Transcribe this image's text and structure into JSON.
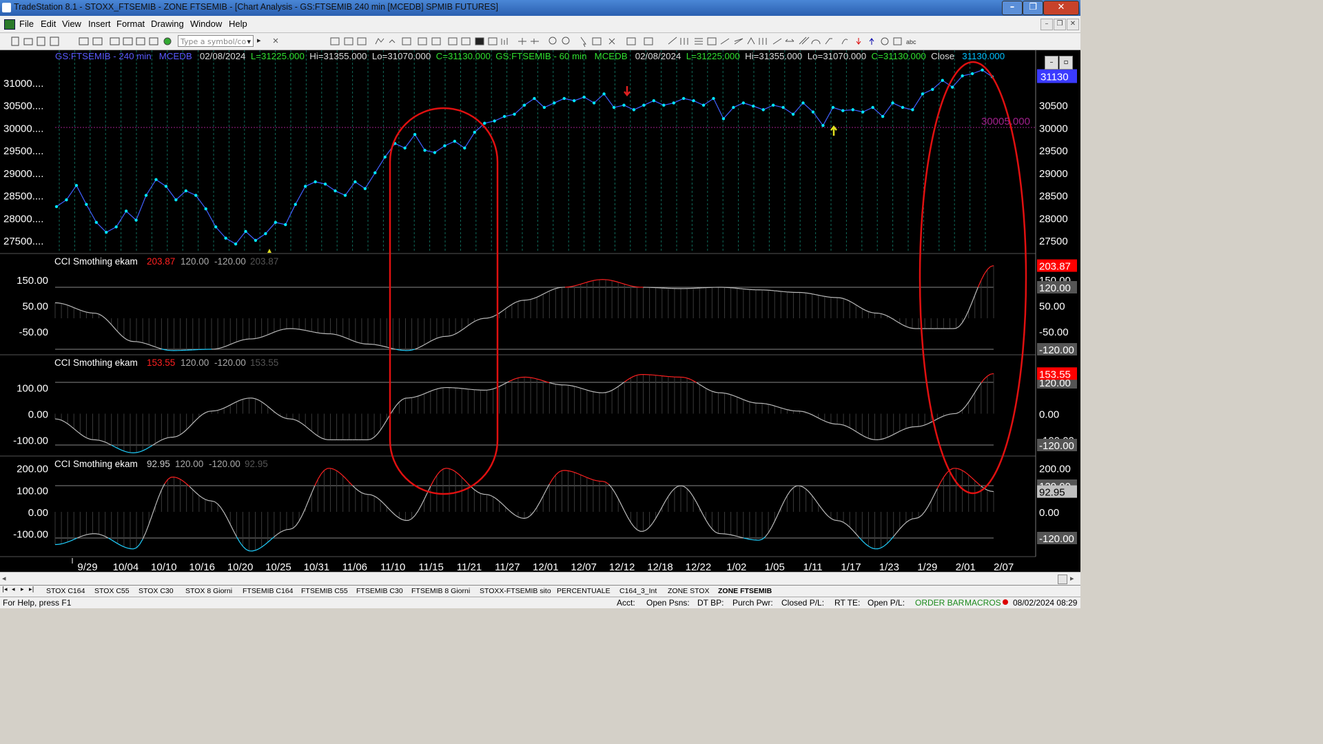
{
  "window": {
    "title": "TradeStation 8.1 - STOXX_FTSEMIB - ZONE FTSEMIB - [Chart Analysis - GS:FTSEMIB  240 min  [MCEDB] SPMIB FUTURES]"
  },
  "menu": {
    "items": [
      "File",
      "Edit",
      "View",
      "Insert",
      "Format",
      "Drawing",
      "Window",
      "Help"
    ]
  },
  "toolbar": {
    "symbol_placeholder": "Type a symbol/co"
  },
  "header": {
    "s1_name": "GS:FTSEMIB - 240 min",
    "s1_feed": "MCEDB",
    "s1_date": "02/08/2024",
    "s1_last": "L=31225.000",
    "s1_hi": "Hi=31355.000",
    "s1_lo": "Lo=31070.000",
    "s1_close": "C=31130.000",
    "s2_name": "GS:FTSEMIB - 60 min",
    "s2_feed": "MCEDB",
    "s2_date": "02/08/2024",
    "s2_last": "L=31225.000",
    "s2_hi": "Hi=31355.000",
    "s2_lo": "Lo=31070.000",
    "s2_close": "C=31130.000",
    "close_label": "Close",
    "close_value": "31130.000"
  },
  "price_panel": {
    "left_ticks": [
      "31000....",
      "30500....",
      "30000....",
      "29500....",
      "29000....",
      "28500....",
      "28000....",
      "27500...."
    ],
    "right_ticks": [
      "30500",
      "30000",
      "29500",
      "29000",
      "28500",
      "28000",
      "27500"
    ],
    "last_price_badge": "31130",
    "hline_label": "30005.000",
    "colors": {
      "price_line": "#4060ff",
      "markers": "#00e5ff",
      "hline": "#a0208c",
      "badge": "#3a3aff"
    }
  },
  "indicators": [
    {
      "name": "CCI Smothing ekam",
      "value": "203.87",
      "upper": "120.00",
      "lower": "-120.00",
      "value_dim": "203.87",
      "left_ticks": [
        "150.00",
        "50.00",
        "-50.00"
      ],
      "right_ticks": [
        "150.00",
        "120.00",
        "50.00",
        "-50.00",
        "-120.00"
      ],
      "badge": "203.87",
      "badge_color": "#ff0000"
    },
    {
      "name": "CCI Smothing ekam",
      "value": "153.55",
      "upper": "120.00",
      "lower": "-120.00",
      "value_dim": "153.55",
      "left_ticks": [
        "100.00",
        "0.00",
        "-100.00"
      ],
      "right_ticks": [
        "120.00",
        "0.00",
        "-100.00",
        "-120.00"
      ],
      "badge": "153.55",
      "badge_color": "#ff0000"
    },
    {
      "name": "CCI Smothing ekam",
      "value": "92.95",
      "upper": "120.00",
      "lower": "-120.00",
      "value_dim": "92.95",
      "left_ticks": [
        "200.00",
        "100.00",
        "0.00",
        "-100.00"
      ],
      "right_ticks": [
        "200.00",
        "120.00",
        "0.00",
        "-120.00"
      ],
      "badge": "92.95",
      "badge_color": "#c0c0c0"
    }
  ],
  "x_axis": {
    "dates": [
      "9/29",
      "10/04",
      "10/10",
      "10/16",
      "10/20",
      "10/25",
      "10/31",
      "11/06",
      "11/10",
      "11/15",
      "11/21",
      "11/27",
      "12/01",
      "12/07",
      "12/12",
      "12/18",
      "12/22",
      "1/02",
      "1/05",
      "1/11",
      "1/17",
      "1/23",
      "1/29",
      "2/01",
      "2/07"
    ]
  },
  "chart_data": [
    {
      "type": "line",
      "title": "GS:FTSEMIB - 240 min",
      "ylim": [
        27300,
        31400
      ],
      "x": [
        "9/26",
        "9/27",
        "9/28",
        "9/29",
        "10/02",
        "10/03",
        "10/04",
        "10/05",
        "10/06",
        "10/09",
        "10/10",
        "10/11",
        "10/12",
        "10/13",
        "10/16",
        "10/17",
        "10/18",
        "10/19",
        "10/20",
        "10/23",
        "10/24",
        "10/25",
        "10/26",
        "10/27",
        "10/30",
        "10/31",
        "11/01",
        "11/02",
        "11/03",
        "11/06",
        "11/07",
        "11/08",
        "11/09",
        "11/10",
        "11/13",
        "11/14",
        "11/15",
        "11/16",
        "11/17",
        "11/20",
        "11/21",
        "11/22",
        "11/23",
        "11/24",
        "11/27",
        "11/28",
        "11/29",
        "11/30",
        "12/01",
        "12/04",
        "12/05",
        "12/06",
        "12/07",
        "12/08",
        "12/11",
        "12/12",
        "12/13",
        "12/14",
        "12/15",
        "12/18",
        "12/19",
        "12/20",
        "12/21",
        "12/22",
        "12/27",
        "12/28",
        "12/29",
        "1/02",
        "1/03",
        "1/04",
        "1/05",
        "1/08",
        "1/09",
        "1/10",
        "1/11",
        "1/12",
        "1/15",
        "1/16",
        "1/17",
        "1/18",
        "1/19",
        "1/22",
        "1/23",
        "1/24",
        "1/25",
        "1/26",
        "1/29",
        "1/30",
        "1/31",
        "2/01",
        "2/02",
        "2/05",
        "2/06",
        "2/07",
        "2/08"
      ],
      "values": [
        28250,
        28400,
        28720,
        28300,
        27900,
        27680,
        27800,
        28150,
        27950,
        28500,
        28850,
        28700,
        28400,
        28600,
        28500,
        28200,
        27800,
        27550,
        27420,
        27700,
        27500,
        27650,
        27900,
        27850,
        28300,
        28700,
        28800,
        28750,
        28600,
        28500,
        28800,
        28650,
        29000,
        29350,
        29650,
        29550,
        29850,
        29500,
        29450,
        29600,
        29700,
        29550,
        29900,
        30100,
        30150,
        30250,
        30300,
        30500,
        30650,
        30450,
        30550,
        30650,
        30600,
        30680,
        30550,
        30750,
        30450,
        30500,
        30400,
        30500,
        30600,
        30500,
        30550,
        30650,
        30600,
        30500,
        30650,
        30200,
        30450,
        30550,
        30480,
        30400,
        30500,
        30450,
        30300,
        30550,
        30350,
        30050,
        30450,
        30380,
        30400,
        30350,
        30450,
        30250,
        30550,
        30450,
        30400,
        30750,
        30850,
        31050,
        30900,
        31150,
        31200,
        31280,
        31130
      ],
      "annotations": [
        {
          "type": "hline",
          "value": 30005,
          "label": "30005.000"
        }
      ]
    },
    {
      "type": "line",
      "title": "CCI Smothing ekam",
      "ylim": [
        -130,
        230
      ],
      "levels": [
        120,
        -120
      ],
      "x": [
        0,
        4,
        8,
        12,
        16,
        20,
        24,
        28,
        32,
        36,
        40,
        44,
        48,
        52,
        56,
        60,
        64,
        68,
        72,
        76,
        80,
        84,
        88,
        92,
        96
      ],
      "values": [
        60,
        20,
        -90,
        -125,
        -120,
        -80,
        -40,
        -60,
        -100,
        -125,
        -70,
        0,
        70,
        120,
        150,
        120,
        115,
        120,
        110,
        100,
        80,
        20,
        -40,
        -40,
        203.87
      ]
    },
    {
      "type": "line",
      "title": "CCI Smothing ekam",
      "ylim": [
        -160,
        200
      ],
      "levels": [
        120,
        -120
      ],
      "x": [
        0,
        4,
        8,
        12,
        16,
        20,
        24,
        28,
        32,
        36,
        40,
        44,
        48,
        52,
        56,
        60,
        64,
        68,
        72,
        76,
        80,
        84,
        88,
        92,
        96
      ],
      "values": [
        -20,
        -100,
        -150,
        -90,
        10,
        60,
        -20,
        -100,
        -100,
        60,
        100,
        90,
        140,
        110,
        80,
        150,
        140,
        80,
        40,
        10,
        -40,
        -100,
        -50,
        0,
        153.55
      ]
    },
    {
      "type": "line",
      "title": "CCI Smothing ekam",
      "ylim": [
        -200,
        250
      ],
      "levels": [
        120,
        -120
      ],
      "x": [
        0,
        4,
        8,
        12,
        16,
        20,
        24,
        28,
        32,
        36,
        40,
        44,
        48,
        52,
        56,
        60,
        64,
        68,
        72,
        76,
        80,
        84,
        88,
        92,
        96
      ],
      "values": [
        -150,
        -100,
        -170,
        160,
        50,
        -180,
        -80,
        200,
        80,
        -40,
        200,
        80,
        -30,
        190,
        140,
        -90,
        120,
        -100,
        -130,
        120,
        -40,
        -170,
        -30,
        200,
        92.95
      ]
    }
  ],
  "tabs": [
    "STOX C164",
    "STOX C55",
    "STOX  C30",
    "STOX  8 Giorni",
    "FTSEMIB C164",
    "FTSEMIB C55",
    "FTSEMIB C30",
    "FTSEMIB  8 Giorni",
    "STOXX-FTSEMIB sito",
    "PERCENTUALE",
    "C164_3_Int",
    "ZONE STOX",
    "ZONE FTSEMIB"
  ],
  "status": {
    "help": "For Help, press F1",
    "acct": "Acct:",
    "open_psns": "Open Psns:",
    "dt_bp": "DT BP:",
    "purch_pwr": "Purch Pwr:",
    "closed_pl": "Closed P/L:",
    "rt_te": "RT TE:",
    "open_pl": "Open P/L:",
    "order_bar": "ORDER BAR",
    "macros": "MACROS",
    "datetime": "08/02/2024 08:29"
  }
}
